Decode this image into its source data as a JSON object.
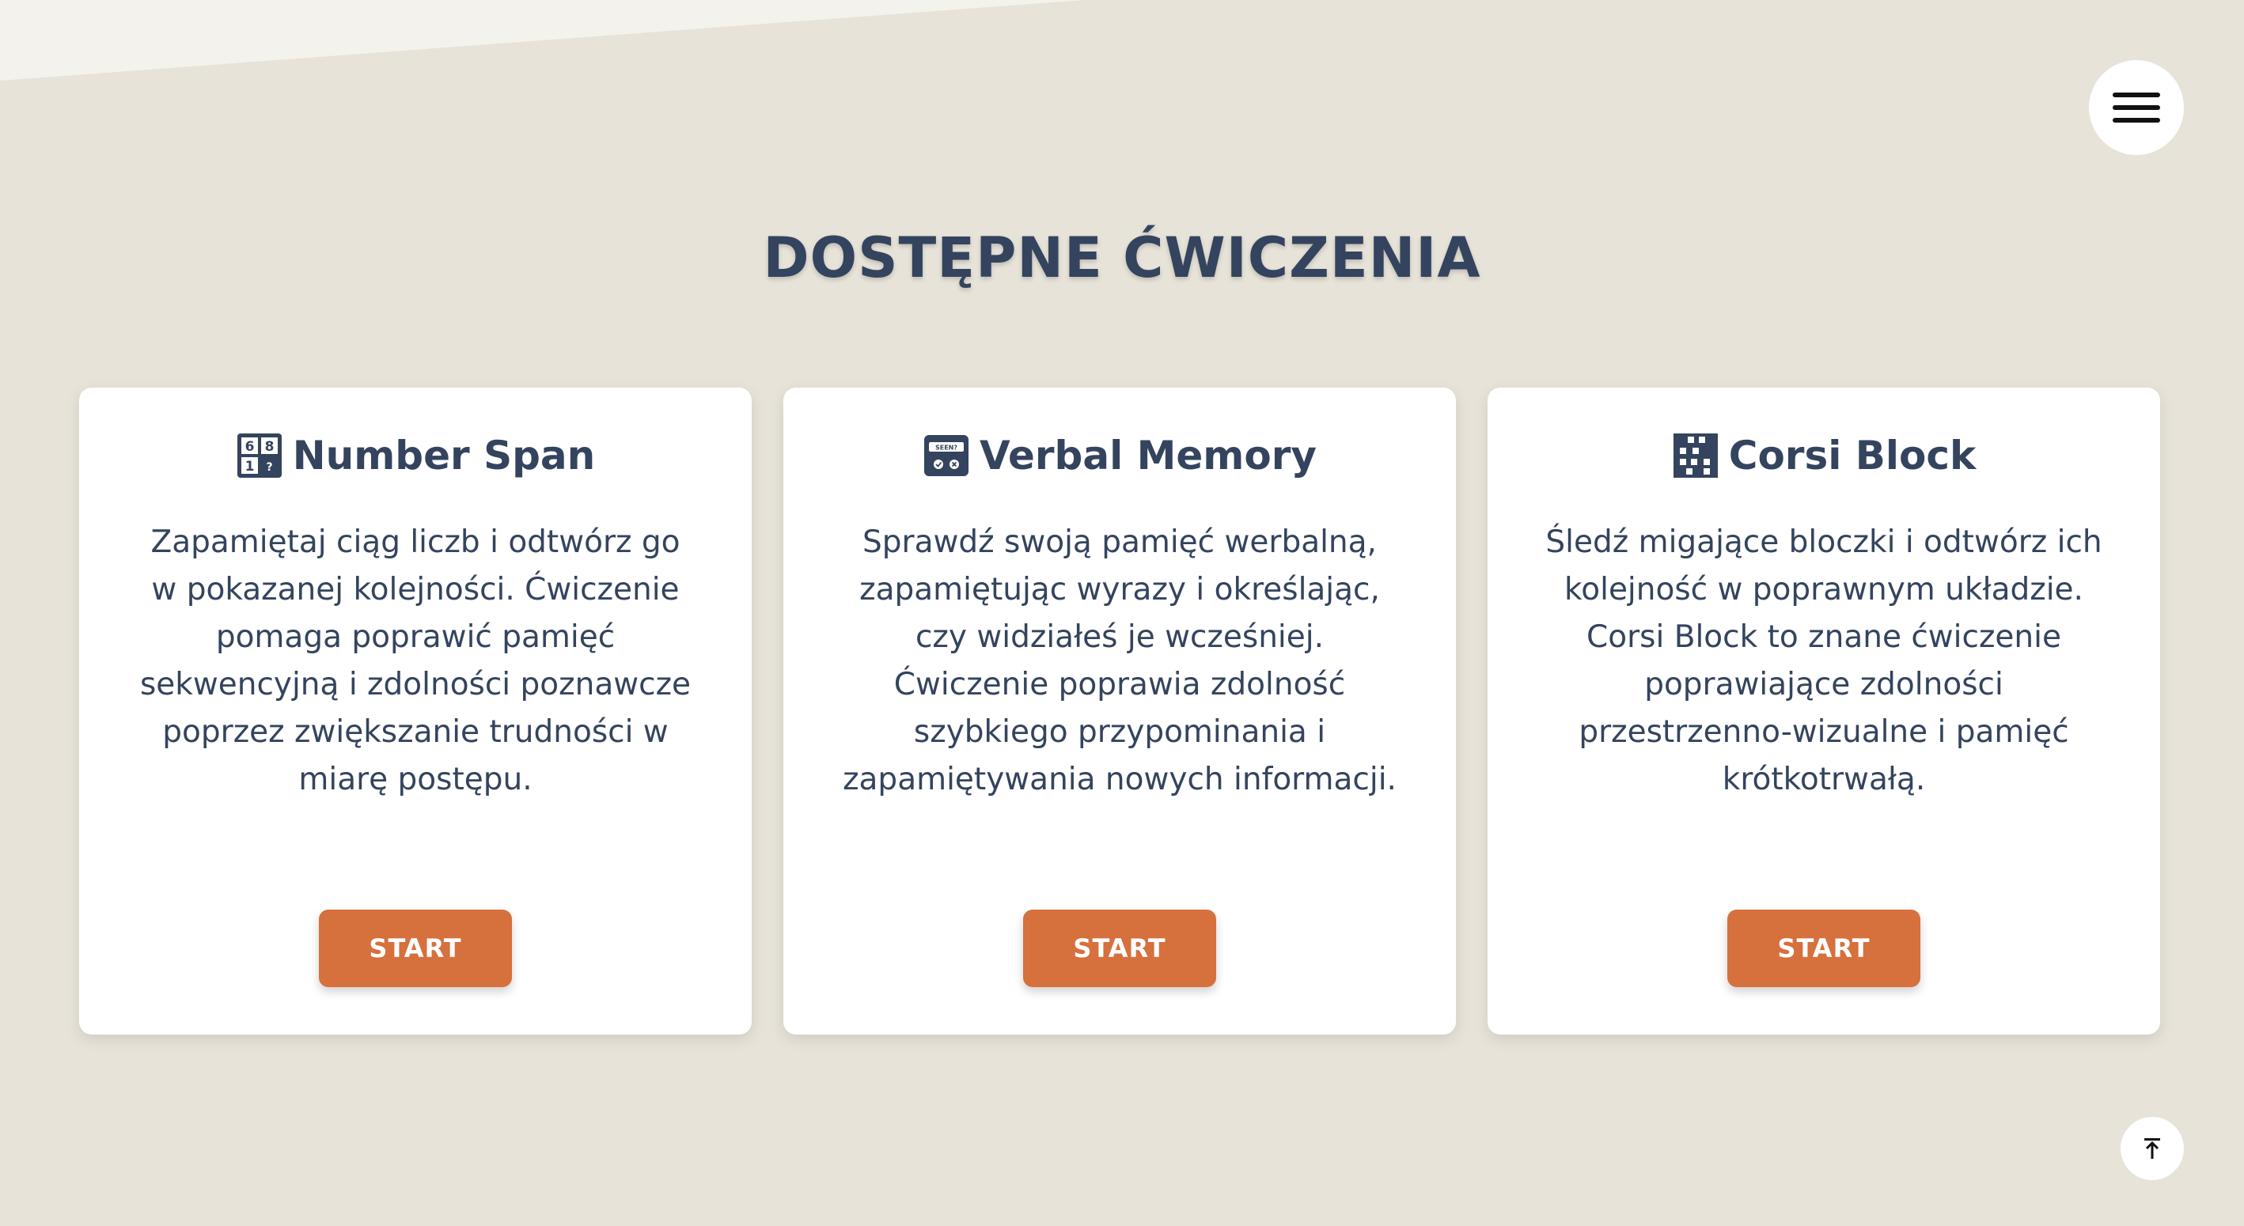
{
  "colors": {
    "background": "#e7e3d9",
    "accent": "#d6703d",
    "text": "#34445e",
    "card": "#ffffff"
  },
  "header": {
    "menu_icon": "hamburger-menu-icon"
  },
  "page": {
    "title": "DOSTĘPNE ĆWICZENIA"
  },
  "cards": [
    {
      "title": "Number Span",
      "icon": "number-grid-icon",
      "description": "Zapamiętaj ciąg liczb i odtwórz go w pokazanej kolejności. Ćwiczenie pomaga poprawić pamięć sekwencyjną i zdolności poznawcze poprzez zwiększanie trudności w miarę postępu.",
      "button_label": "START"
    },
    {
      "title": "Verbal Memory",
      "icon": "seen-card-icon",
      "description": "Sprawdź swoją pamięć werbalną, zapamiętując wyrazy i określając, czy widziałeś je wcześniej. Ćwiczenie poprawia zdolność szybkiego przypominania i zapamiętywania nowych informacji.",
      "button_label": "START"
    },
    {
      "title": "Corsi Block",
      "icon": "blocks-grid-icon",
      "description": "Śledź migające bloczki i odtwórz ich kolejność w poprawnym układzie. Corsi Block to znane ćwiczenie poprawiające zdolności przestrzenno-wizualne i pamięć krótkotrwałą.",
      "button_label": "START"
    }
  ],
  "footer": {
    "scroll_top_icon": "arrow-up-to-top-icon"
  }
}
